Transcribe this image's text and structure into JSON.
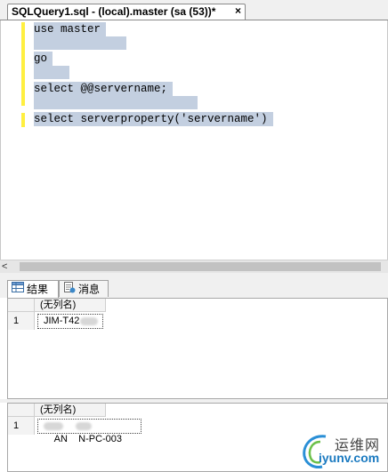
{
  "tab": {
    "title": "SQLQuery1.sql - (local).master (sa (53))*",
    "close_glyph": "×"
  },
  "editor": {
    "lines": [
      "use master",
      "go",
      "select @@servername;",
      "select serverproperty('servername')"
    ],
    "selection_color": "#c3cfe0",
    "change_marker_color": "#ffef40"
  },
  "scrollbar": {
    "left_arrow": "<"
  },
  "results_tabs": [
    {
      "label": "结果",
      "icon": "grid-icon",
      "active": true
    },
    {
      "label": "消息",
      "icon": "message-icon",
      "active": false
    }
  ],
  "result_sets": [
    {
      "column": "(无列名)",
      "row_number": "1",
      "value": "JIM-T42"
    },
    {
      "column": "(无列名)",
      "row_number": "1",
      "value": "AN    N-PC-003"
    }
  ],
  "watermark": {
    "text_cn": "运维网",
    "url": "iyunv.com"
  }
}
